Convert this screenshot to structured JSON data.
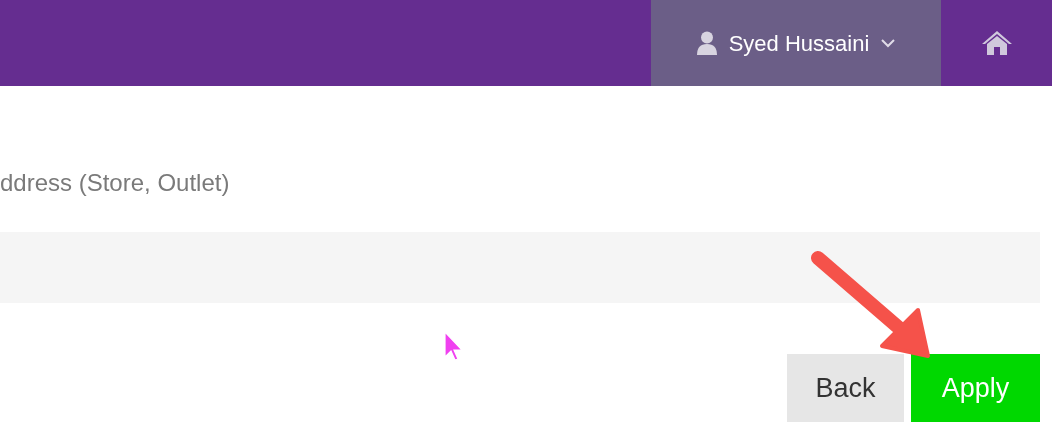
{
  "header": {
    "user_menu": {
      "label": "Syed Hussaini"
    }
  },
  "form": {
    "field_label": "ddress (Store, Outlet)"
  },
  "buttons": [
    {
      "label": "Back",
      "kind": "secondary"
    },
    {
      "label": "Apply",
      "kind": "primary"
    }
  ]
}
